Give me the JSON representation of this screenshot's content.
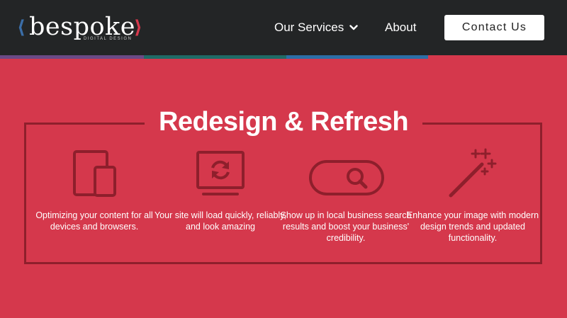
{
  "header": {
    "logo": {
      "word": "bespoke",
      "left_bracket": "⟨",
      "right_bracket": "⟩",
      "tagline": "DIGITAL DESIGN"
    },
    "nav": {
      "services_label": "Our Services",
      "about_label": "About"
    },
    "cta_label": "Contact Us"
  },
  "section": {
    "title": "Redesign & Refresh",
    "features": [
      {
        "icon": "devices-icon",
        "text": "Optimizing your content for all devices and browsers."
      },
      {
        "icon": "monitor-refresh-icon",
        "text": "Your site will load quickly, reliably, and look amazing"
      },
      {
        "icon": "search-bar-icon",
        "text": "Show up in local business search results and boost your business' credibility."
      },
      {
        "icon": "magic-wand-icon",
        "text": "Enhance your image with modern design trends and updated functionality."
      }
    ]
  },
  "colors": {
    "background": "#d5384c",
    "header": "#232526",
    "icon_line": "#8e1f2c",
    "stripe_purple": "#6b4a86",
    "stripe_teal": "#1f6b66",
    "stripe_blue": "#2c6fa6"
  }
}
